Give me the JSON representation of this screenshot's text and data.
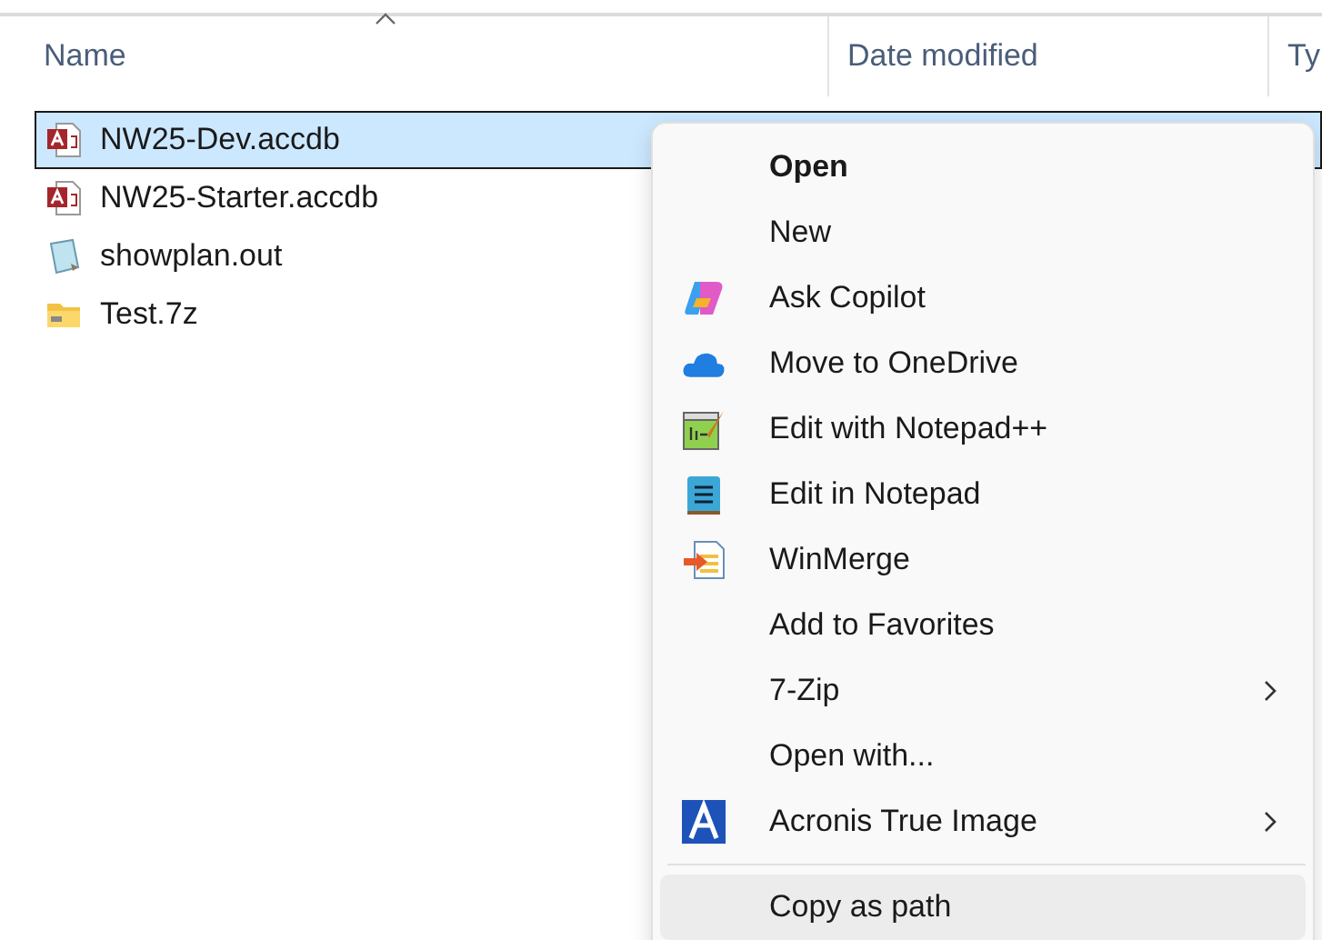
{
  "columns": [
    {
      "label": "Name",
      "sorted": true
    },
    {
      "label": "Date modified",
      "sorted": false
    },
    {
      "label": "Ty",
      "sorted": false
    }
  ],
  "files": [
    {
      "name": "NW25-Dev.accdb",
      "kind": "database",
      "selected": true
    },
    {
      "name": "NW25-Starter.accdb",
      "kind": "database",
      "selected": false
    },
    {
      "name": "showplan.out",
      "kind": "text",
      "selected": false
    },
    {
      "name": "Test.7z",
      "kind": "archive",
      "selected": false
    }
  ],
  "context_menu": {
    "items": [
      {
        "kind": "item",
        "label": "Open",
        "bold": true,
        "submenu": false,
        "highlighted": false
      },
      {
        "kind": "item",
        "label": "New",
        "bold": false,
        "submenu": false,
        "highlighted": false
      },
      {
        "kind": "copilot",
        "label": "Ask Copilot",
        "bold": false,
        "submenu": false,
        "highlighted": false
      },
      {
        "kind": "cloud",
        "label": "Move to OneDrive",
        "bold": false,
        "submenu": false,
        "highlighted": false
      },
      {
        "kind": "notepadpp",
        "label": "Edit with Notepad++",
        "bold": false,
        "submenu": false,
        "highlighted": false
      },
      {
        "kind": "notepad",
        "label": "Edit in Notepad",
        "bold": false,
        "submenu": false,
        "highlighted": false
      },
      {
        "kind": "winmerge",
        "label": "WinMerge",
        "bold": false,
        "submenu": false,
        "highlighted": false
      },
      {
        "kind": "item",
        "label": "Add to Favorites",
        "bold": false,
        "submenu": false,
        "highlighted": false
      },
      {
        "kind": "item",
        "label": "7-Zip",
        "bold": false,
        "submenu": true,
        "highlighted": false
      },
      {
        "kind": "item",
        "label": "Open with...",
        "bold": false,
        "submenu": false,
        "highlighted": false
      },
      {
        "kind": "acronis",
        "label": "Acronis True Image",
        "bold": false,
        "submenu": true,
        "highlighted": false
      },
      {
        "kind": "separator"
      },
      {
        "kind": "item",
        "label": "Copy as path",
        "bold": false,
        "submenu": false,
        "highlighted": true
      }
    ]
  }
}
